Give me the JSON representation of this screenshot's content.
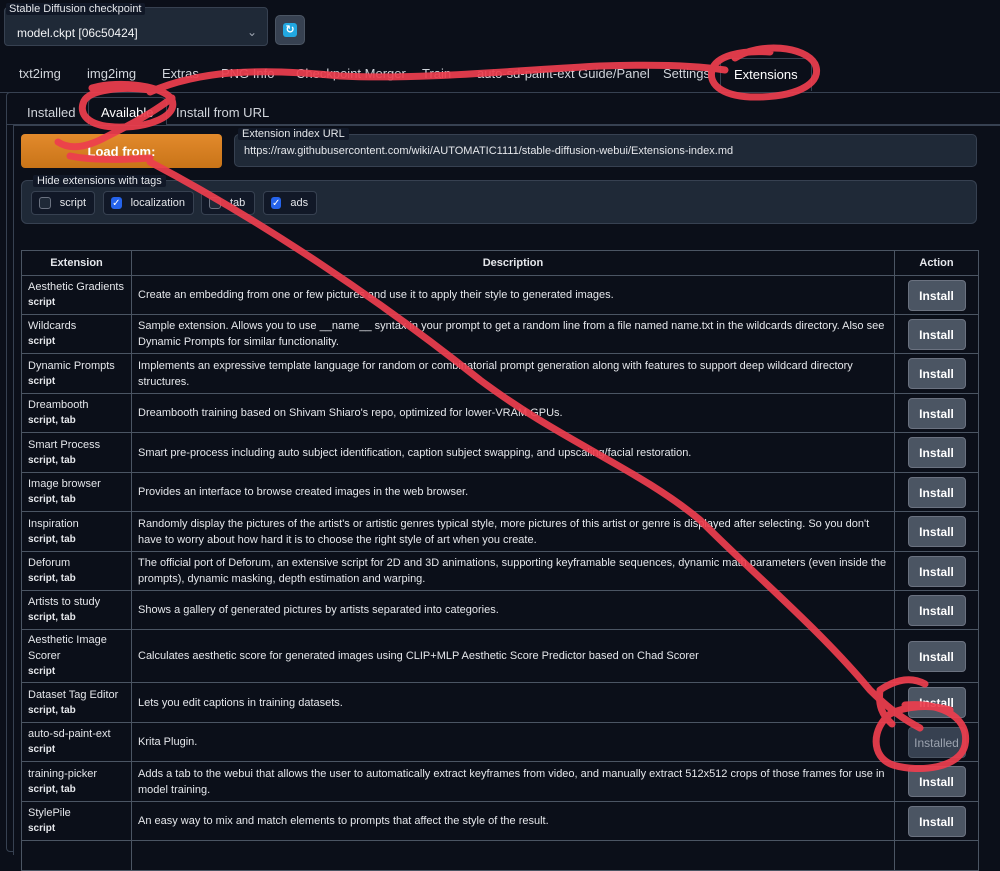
{
  "checkpoint": {
    "label": "Stable Diffusion checkpoint",
    "value": "model.ckpt [06c50424]"
  },
  "main_tabs": [
    {
      "label": "txt2img"
    },
    {
      "label": "img2img"
    },
    {
      "label": "Extras"
    },
    {
      "label": "PNG Info"
    },
    {
      "label": "Checkpoint Merger"
    },
    {
      "label": "Train"
    },
    {
      "label": "auto-sd-paint-ext Guide/Panel"
    },
    {
      "label": "Settings"
    },
    {
      "label": "Extensions"
    }
  ],
  "sub_tabs": [
    {
      "label": "Installed"
    },
    {
      "label": "Available"
    },
    {
      "label": "Install from URL"
    }
  ],
  "load_button": "Load from:",
  "index_url": {
    "label": "Extension index URL",
    "value": "https://raw.githubusercontent.com/wiki/AUTOMATIC1111/stable-diffusion-webui/Extensions-index.md"
  },
  "hide_tags": {
    "label": "Hide extensions with tags",
    "options": [
      {
        "label": "script",
        "checked": false
      },
      {
        "label": "localization",
        "checked": true
      },
      {
        "label": "tab",
        "checked": false
      },
      {
        "label": "ads",
        "checked": true
      }
    ]
  },
  "table": {
    "headers": [
      "Extension",
      "Description",
      "Action"
    ],
    "rows": [
      {
        "name": "Aesthetic Gradients",
        "tags": "script",
        "description": "Create an embedding from one or few pictures and use it to apply their style to generated images.",
        "action": "Install"
      },
      {
        "name": "Wildcards",
        "tags": "script",
        "description": "Sample extension. Allows you to use __name__ syntax in your prompt to get a random line from a file named name.txt in the wildcards directory. Also see Dynamic Prompts for similar functionality.",
        "action": "Install"
      },
      {
        "name": "Dynamic Prompts",
        "tags": "script",
        "description": "Implements an expressive template language for random or combinatorial prompt generation along with features to support deep wildcard directory structures.",
        "action": "Install"
      },
      {
        "name": "Dreambooth",
        "tags": "script, tab",
        "description": "Dreambooth training based on Shivam Shiaro's repo, optimized for lower-VRAM GPUs.",
        "action": "Install"
      },
      {
        "name": "Smart Process",
        "tags": "script, tab",
        "description": "Smart pre-process including auto subject identification, caption subject swapping, and upscaling/facial restoration.",
        "action": "Install"
      },
      {
        "name": "Image browser",
        "tags": "script, tab",
        "description": "Provides an interface to browse created images in the web browser.",
        "action": "Install"
      },
      {
        "name": "Inspiration",
        "tags": "script, tab",
        "description": "Randomly display the pictures of the artist's or artistic genres typical style, more pictures of this artist or genre is displayed after selecting. So you don't have to worry about how hard it is to choose the right style of art when you create.",
        "action": "Install"
      },
      {
        "name": "Deforum",
        "tags": "script, tab",
        "description": "The official port of Deforum, an extensive script for 2D and 3D animations, supporting keyframable sequences, dynamic math parameters (even inside the prompts), dynamic masking, depth estimation and warping.",
        "action": "Install"
      },
      {
        "name": "Artists to study",
        "tags": "script, tab",
        "description": "Shows a gallery of generated pictures by artists separated into categories.",
        "action": "Install"
      },
      {
        "name": "Aesthetic Image Scorer",
        "tags": "script",
        "description": "Calculates aesthetic score for generated images using CLIP+MLP Aesthetic Score Predictor based on Chad Scorer",
        "action": "Install"
      },
      {
        "name": "Dataset Tag Editor",
        "tags": "script, tab",
        "description": "Lets you edit captions in training datasets.",
        "action": "Install"
      },
      {
        "name": "auto-sd-paint-ext",
        "tags": "script",
        "description": "Krita Plugin.",
        "action": "Installed"
      },
      {
        "name": "training-picker",
        "tags": "script, tab",
        "description": "Adds a tab to the webui that allows the user to automatically extract keyframes from video, and manually extract 512x512 crops of those frames for use in model training.",
        "action": "Install"
      },
      {
        "name": "StylePile",
        "tags": "script",
        "description": "An easy way to mix and match elements to prompts that affect the style of the result.",
        "action": "Install"
      },
      {
        "name": "",
        "tags": "",
        "description": "",
        "action": ""
      }
    ]
  },
  "colors": {
    "annotation": "#ee3e4e",
    "accent": "#d97e1f",
    "background": "#0b0f19"
  }
}
